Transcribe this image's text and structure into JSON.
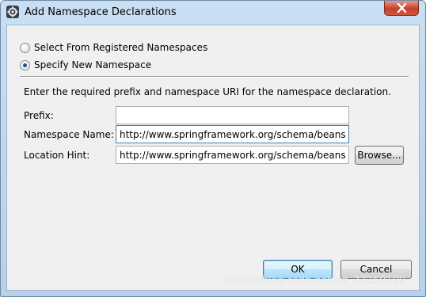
{
  "window": {
    "title": "Add Namespace Declarations",
    "app_icon": "eclipse-gear-icon",
    "close_icon": "close-x-icon"
  },
  "options": {
    "registered_label": "Select From Registered Namespaces",
    "registered_checked": false,
    "new_label": "Specify New Namespace",
    "new_checked": true
  },
  "instructions": "Enter the required prefix and namespace URI for the namespace declaration.",
  "form": {
    "prefix_label": "Prefix:",
    "prefix_value": "",
    "namespace_label": "Namespace Name:",
    "namespace_value": "http://www.springframework.org/schema/beans",
    "location_label": "Location Hint:",
    "location_value": "http://www.springframework.org/schema/beans/spring-beans.xsd",
    "browse_label": "Browse..."
  },
  "buttons": {
    "ok_label": "OK",
    "cancel_label": "Cancel"
  },
  "watermark": "https://blog.csdn.net/qq_37250199",
  "colors": {
    "title_bar": "#c9dff2",
    "close_button": "#c2412a",
    "dialog_body": "#f0f0f0",
    "default_button_border": "#3c7fb1"
  }
}
